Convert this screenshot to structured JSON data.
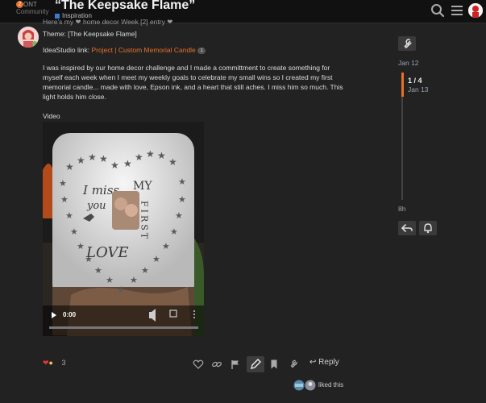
{
  "header": {
    "logo_text_1": "ONT",
    "logo_text_2": "Community",
    "title": "“The Keepsake Flame”",
    "category": "Inspiration",
    "category_color": "#3a7bd5"
  },
  "post": {
    "clipped_line": "Here’s my ❤ home decor Week [2] entry ❤",
    "theme": "Theme: [The Keepsake Flame]",
    "idea_label": "IdeaStudio link:",
    "idea_link": "Project | Custom Memorial Candle",
    "idea_count": "1",
    "body": "I was inspired by our home decor challenge and I made a committment to create something for myself each week when I meet my weekly goals to celebrate my small wins so I created my first memorial candle... made with love, Epson ink, and a heart that still aches. I miss him so much. This light holds him close.",
    "video_label": "Video",
    "video_time": "0:00",
    "candle_text_1": "I miss",
    "candle_text_2": "you",
    "candle_text_3": "LOVE",
    "candle_text_4": "MY",
    "candle_text_5": "FIRST"
  },
  "timeline": {
    "start_date": "Jan 12",
    "progress": "1 / 4",
    "current_date": "Jan 13",
    "end_label": "8h"
  },
  "footer": {
    "reaction_count": "3",
    "reply_label": "Reply",
    "liked_text": "liked this"
  },
  "colors": {
    "accent": "#e8702a",
    "background": "#222222",
    "header": "#111111"
  }
}
